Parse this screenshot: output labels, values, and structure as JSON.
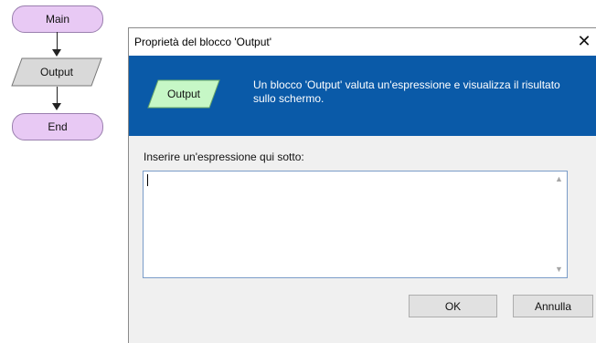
{
  "flowchart": {
    "start_label": "Main",
    "output_label": "Output",
    "end_label": "End"
  },
  "dialog": {
    "title": "Proprietà del blocco 'Output'",
    "close_glyph": "✕",
    "banner_shape_label": "Output",
    "banner_description": "Un blocco 'Output' valuta un'espressione e visualizza il risultato sullo schermo.",
    "prompt_label": "Inserire un'espressione qui sotto:",
    "expression_value": "",
    "scroll_up_glyph": "▲",
    "scroll_down_glyph": "▼",
    "ok_label": "OK",
    "cancel_label": "Annulla"
  },
  "colors": {
    "terminal_fill": "#e8c9f4",
    "io_fill": "#d9d9d9",
    "banner_bg": "#0a5aa8",
    "output_shape_fill": "#c6f7c6"
  },
  "icons": [
    "close-icon",
    "scroll-up-icon",
    "scroll-down-icon"
  ]
}
